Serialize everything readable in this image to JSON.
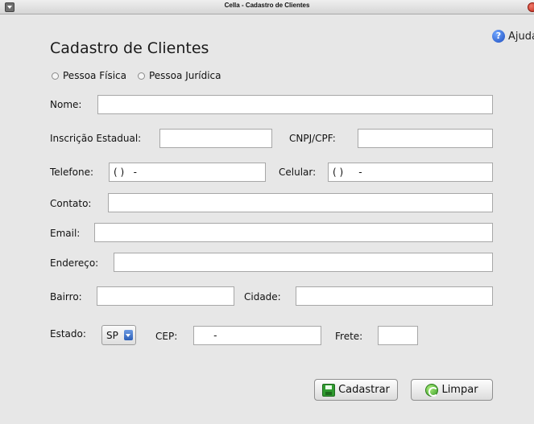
{
  "window": {
    "title": "Cella - Cadastro de Clientes"
  },
  "help": {
    "label": "Ajuda"
  },
  "page": {
    "title": "Cadastro de Clientes"
  },
  "person_type": {
    "fisica": "Pessoa Física",
    "juridica": "Pessoa Jurídica"
  },
  "form": {
    "nome_label": "Nome:",
    "nome_value": "",
    "inscricao_label": "Inscrição Estadual:",
    "inscricao_value": "",
    "cnpj_label": "CNPJ/CPF:",
    "cnpj_value": "",
    "telefone_label": "Telefone:",
    "telefone_value": "( )   -",
    "celular_label": "Celular:",
    "celular_value": "( )     -",
    "contato_label": "Contato:",
    "contato_value": "",
    "email_label": "Email:",
    "email_value": "",
    "endereco_label": "Endereço:",
    "endereco_value": "",
    "bairro_label": "Bairro:",
    "bairro_value": "",
    "cidade_label": "Cidade:",
    "cidade_value": "",
    "estado_label": "Estado:",
    "estado_value": "SP",
    "cep_label": "CEP:",
    "cep_value": "     -",
    "frete_label": "Frete:",
    "frete_value": ""
  },
  "buttons": {
    "cadastrar": "Cadastrar",
    "limpar": "Limpar"
  },
  "icons": {
    "window_menu": "window-menu-icon",
    "close": "close-icon",
    "help": "help-icon",
    "save": "save-icon",
    "clear": "refresh-icon"
  },
  "colors": {
    "background": "#e7e7e7",
    "help_blue": "#1f4fc0",
    "button_green": "#2f9a2f"
  }
}
